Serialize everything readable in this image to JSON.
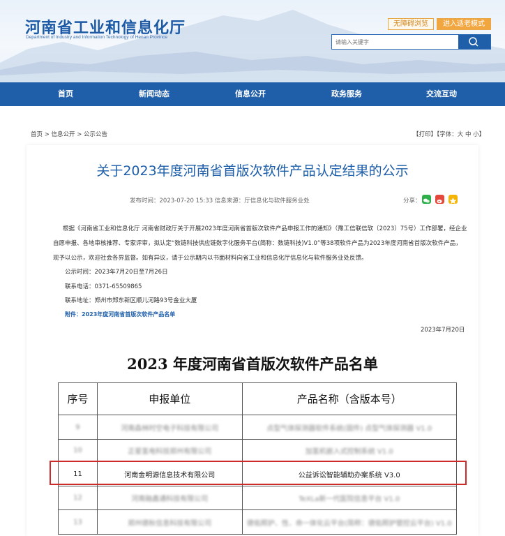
{
  "header": {
    "site_title": "河南省工业和信息化厅",
    "site_title_en": "Department of Industry and Information Technology of Henan Province",
    "accessibility_label": "无障碍浏览",
    "elder_mode_label": "进入适老模式",
    "search_placeholder": "请输入关键字"
  },
  "nav": {
    "items": [
      "首页",
      "新闻动态",
      "信息公开",
      "政务服务",
      "交流互动"
    ]
  },
  "breadcrumb": "首页 > 信息公开 > 公示公告",
  "print_tools": "【打印】【字体：大 中 小】",
  "article": {
    "title": "关于2023年度河南省首版次软件产品认定结果的公示",
    "meta": "发布时间：2023-07-20 15:33    信息来源：厅信息化与软件服务业处",
    "share_label": "分享：",
    "body": "根据《河南省工业和信息化厅    河南省财政厅关于开展2023年度河南省首版次软件产品申报工作的通知》（豫工信联信软〔2023〕75号）工作部署，经企业自愿申报、各地审核推荐、专家评审，拟认定“数链科技供应链数字化服务平台(简称：数链科技)V1.0”等38项软件产品为2023年度河南省首版次软件产品，现予以公示，欢迎社会各界监督。如有异议，请于公示期内以书面材料向省工业和信息化厅信息化与软件服务业处反馈。",
    "publicity_period": "公示时间：2023年7月20日至7月26日",
    "phone": "联系电话：0371-65509865",
    "address": "联系地址：郑州市郑东新区顺儿河路93号金业大厦",
    "attachment": "附件：2023年度河南省首版次软件产品名单",
    "date": "2023年7月20日"
  },
  "list": {
    "heading": "2023 年度河南省首版次软件产品名单",
    "columns": [
      "序号",
      "申报单位",
      "产品名称（含版本号）"
    ],
    "rows": [
      {
        "no": "9",
        "unit": "河南森林时空电子科技有限公司",
        "product": "点型气体探测器软件系统(固件) 点型气体探测器 V1.0"
      },
      {
        "no": "10",
        "unit": "正星氢电科技郑州有限公司",
        "product": "加氢机嵌入式控制系统 V1.0"
      },
      {
        "no": "11",
        "unit": "河南金明源信息技术有限公司",
        "product": "公益诉讼智能辅助办案系统 V3.0"
      },
      {
        "no": "12",
        "unit": "河南融鑫通科技有限公司",
        "product": "TeXLa新一代医院信息平台 V1.0"
      },
      {
        "no": "13",
        "unit": "郑州德秋信息科技有限公司",
        "product": "德佑照护、性、命一体化云平台(简称：德佑照护管控云平台) V1.0"
      }
    ]
  },
  "colors": {
    "brand_blue": "#1f5ea8",
    "title_blue": "#1d5ea9",
    "highlight_red": "#cf2a2a",
    "accent_orange": "#f2a640"
  }
}
